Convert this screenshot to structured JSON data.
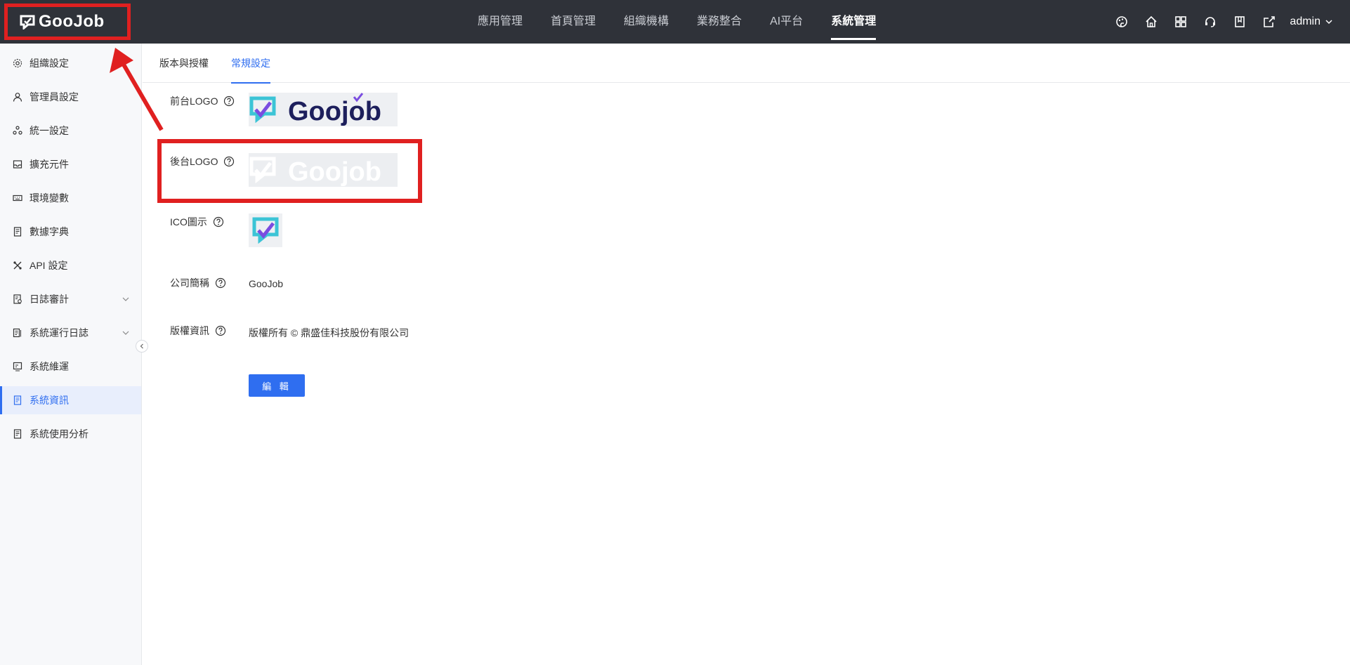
{
  "header": {
    "brand": "GooJob",
    "nav": [
      {
        "label": "應用管理"
      },
      {
        "label": "首頁管理"
      },
      {
        "label": "組織機構"
      },
      {
        "label": "業務整合"
      },
      {
        "label": "AI平台"
      },
      {
        "label": "系統管理",
        "active": true
      }
    ],
    "icons": [
      "palette-icon",
      "home-icon",
      "apps-grid-icon",
      "headset-icon",
      "book-icon",
      "export-icon"
    ],
    "user": "admin"
  },
  "sidebar": {
    "items": [
      {
        "label": "組織設定",
        "icon": "gear-icon"
      },
      {
        "label": "管理員設定",
        "icon": "user-icon"
      },
      {
        "label": "統一設定",
        "icon": "cluster-icon"
      },
      {
        "label": "擴充元件",
        "icon": "inbox-icon"
      },
      {
        "label": "環境變數",
        "icon": "keyboard-icon"
      },
      {
        "label": "數據字典",
        "icon": "document-icon"
      },
      {
        "label": "API 設定",
        "icon": "tools-icon"
      },
      {
        "label": "日誌審計",
        "icon": "audit-icon",
        "expandable": true
      },
      {
        "label": "系統運行日誌",
        "icon": "log-icon",
        "expandable": true
      },
      {
        "label": "系統維運",
        "icon": "maintenance-icon"
      },
      {
        "label": "系統資訊",
        "icon": "info-doc-icon",
        "active": true
      },
      {
        "label": "系統使用分析",
        "icon": "analysis-icon"
      }
    ]
  },
  "tabs": [
    {
      "label": "版本與授權"
    },
    {
      "label": "常規設定",
      "active": true
    }
  ],
  "form": {
    "front_logo_label": "前台LOGO",
    "back_logo_label": "後台LOGO",
    "ico_label": "ICO圖示",
    "company_label": "公司簡稱",
    "company_value": "GooJob",
    "copyright_label": "版權資訊",
    "copyright_value": "版權所有 © 鼎盛佳科技股份有限公司",
    "edit_button": "編 輯",
    "logo_text": "Goojob"
  },
  "colors": {
    "header_bg": "#2f3239",
    "accent": "#2f6ef0",
    "annotation": "#e02020",
    "logo_navy": "#1d1f5c"
  }
}
